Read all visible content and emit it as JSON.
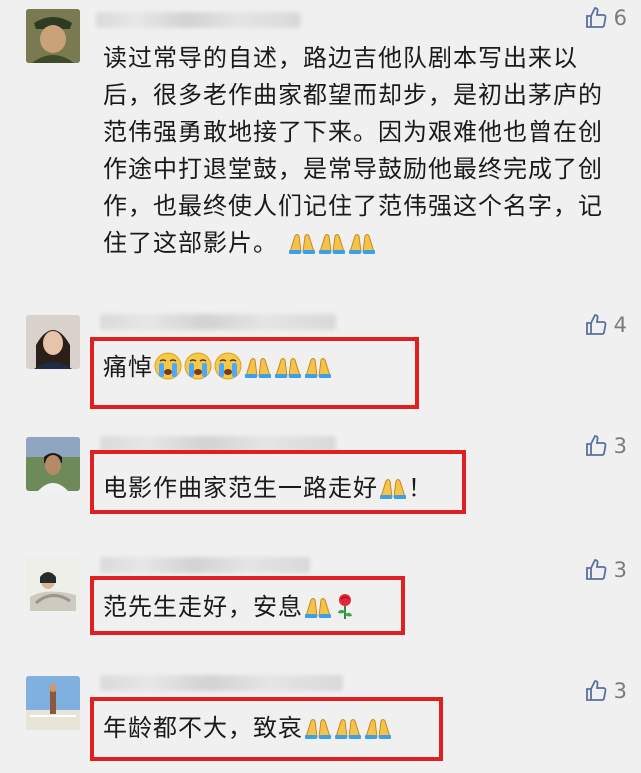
{
  "comments": [
    {
      "likes": "6",
      "text": "读过常导的自述，路边吉他队剧本写出来以后，很多老作曲家都望而却步，是初出茅庐的范伟强勇敢地接了下来。因为艰难他也曾在创作途中打退堂鼓，是常导鼓励他最终完成了创作，也最终使人们记住了范伟强这个名字，记住了这部影片。",
      "emoji": [
        "pray",
        "pray",
        "pray"
      ]
    },
    {
      "likes": "4",
      "text": "痛悼",
      "emoji": [
        "cry",
        "cry",
        "cry",
        "pray",
        "pray",
        "pray"
      ]
    },
    {
      "likes": "3",
      "text": "电影作曲家范生一路走好",
      "emoji": [
        "pray"
      ],
      "suffix": "！"
    },
    {
      "likes": "3",
      "text": "范先生走好，安息",
      "emoji": [
        "pray",
        "rose"
      ]
    },
    {
      "likes": "3",
      "text": "年龄都不大，致哀",
      "emoji": [
        "pray",
        "pray",
        "pray"
      ]
    }
  ],
  "icons": {
    "like": "thumbs-up-icon",
    "pray": "praying-hands-emoji",
    "cry": "crying-face-emoji",
    "rose": "rose-emoji"
  },
  "colors": {
    "highlight": "#e02020",
    "text": "#1a1a1a",
    "meta": "#7b7b7b",
    "background": "#f0f0f0"
  }
}
